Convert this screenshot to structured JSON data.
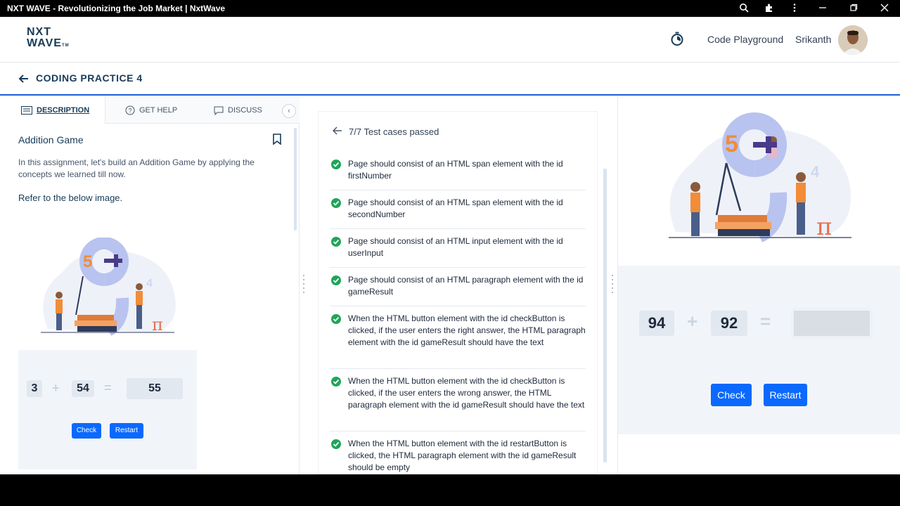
{
  "window": {
    "title": "NXT WAVE - Revolutionizing the Job Market | NxtWave"
  },
  "header": {
    "logo_line1": "NXT",
    "logo_line2": "WAVE",
    "logo_tm": "TM",
    "playground": "Code Playground",
    "user": "Srikanth"
  },
  "breadcrumb": {
    "label": "CODING PRACTICE 4"
  },
  "tabs": [
    {
      "label": "DESCRIPTION"
    },
    {
      "label": "GET HELP"
    },
    {
      "label": "DISCUSS"
    }
  ],
  "description": {
    "title": "Addition Game",
    "intro": "In this assignment, let's build an Addition Game by applying the concepts we learned till now.",
    "refer": "Refer to the below image.",
    "preview": {
      "first": "3",
      "second": "54",
      "answer": "55",
      "check": "Check",
      "restart": "Restart",
      "plus": "+",
      "equals": "="
    }
  },
  "tests": {
    "summary": "7/7 Test cases passed",
    "cases": [
      "Page should consist of an HTML span element with the id firstNumber",
      "Page should consist of an HTML span element with the id secondNumber",
      "Page should consist of an HTML input element with the id userInput",
      "Page should consist of an HTML paragraph element with the id gameResult",
      "When the HTML button element with the id checkButton is clicked, if the user enters the right answer, the HTML paragraph element with the id gameResult should have the text",
      "When the HTML button element with the id checkButton is clicked, if the user enters the wrong answer, the HTML paragraph element with the id gameResult should have the text",
      "When the HTML button element with the id restartButton is clicked, the HTML paragraph element with the id gameResult should be empty"
    ]
  },
  "output": {
    "first": "94",
    "second": "92",
    "plus": "+",
    "equals": "=",
    "check": "Check",
    "restart": "Restart"
  },
  "colors": {
    "accent": "#0b69ff",
    "pass": "#1fa55a",
    "navy": "#183b56"
  },
  "icons": [
    "search-icon",
    "extension-icon",
    "more-icon",
    "minimize-icon",
    "maximize-icon",
    "close-icon",
    "timer-icon",
    "back-arrow-icon",
    "description-icon",
    "help-icon",
    "discuss-icon",
    "chevron-left-icon",
    "bookmark-icon",
    "check-circle-icon"
  ]
}
